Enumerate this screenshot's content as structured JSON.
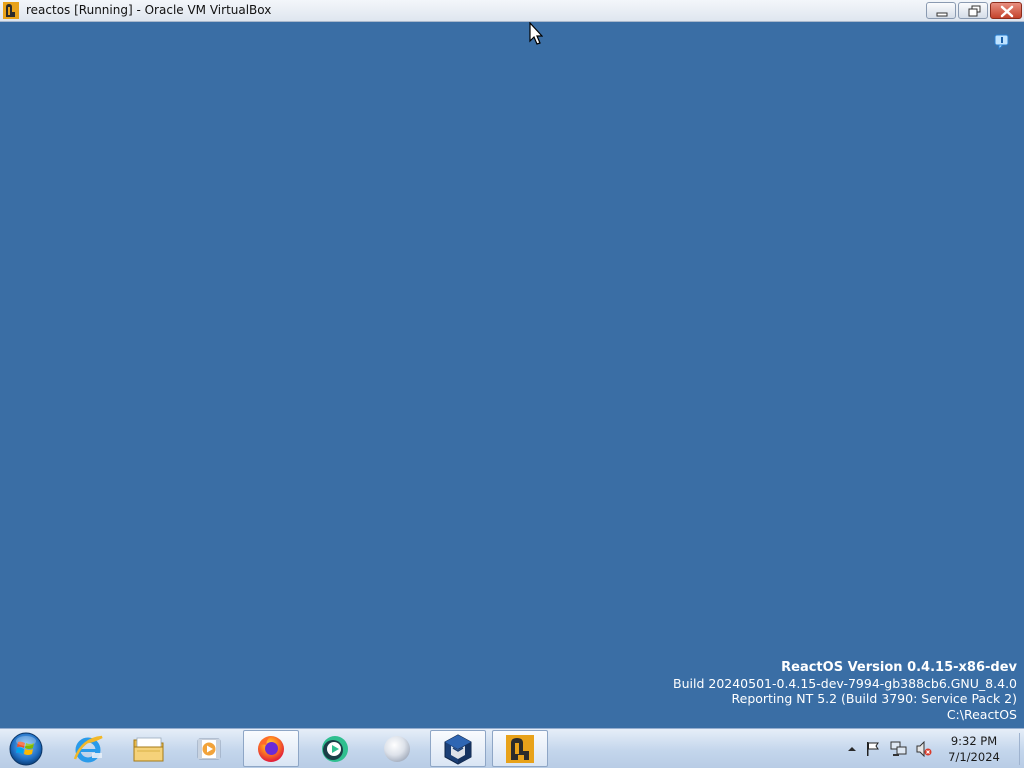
{
  "window": {
    "title": "reactos [Running] - Oracle VM VirtualBox",
    "buttons": [
      "minimize",
      "restore",
      "close"
    ]
  },
  "desktop": {
    "background_color": "#3a6ea5",
    "version_info": {
      "line1": "ReactOS Version 0.4.15-x86-dev",
      "line2": "Build 20240501-0.4.15-dev-7994-gb388cb6.GNU_8.4.0",
      "line3": "Reporting NT 5.2 (Build 3790: Service Pack 2)",
      "line4": "C:\\ReactOS"
    }
  },
  "taskbar": {
    "start_icon": "windows-start-orb-icon",
    "items": [
      {
        "icon": "internet-explorer-icon",
        "active": false
      },
      {
        "icon": "file-explorer-icon",
        "active": false
      },
      {
        "icon": "media-player-icon",
        "active": false
      },
      {
        "icon": "firefox-icon",
        "active": true
      },
      {
        "icon": "green-media-app-icon",
        "active": false
      },
      {
        "icon": "grey-orb-app-icon",
        "active": false
      },
      {
        "icon": "virtualbox-icon",
        "active": true
      },
      {
        "icon": "reactos-vm-icon",
        "active": true
      }
    ],
    "tray": {
      "icons": [
        "show-hidden-icons-arrow",
        "action-center-flag-icon",
        "network-icon",
        "volume-muted-icon"
      ],
      "time": "9:32 PM",
      "date": "7/1/2024"
    }
  },
  "colors": {
    "desktop": "#3a6ea5",
    "close_button": "#c4432c",
    "taskbar": "#c4d6ec"
  }
}
